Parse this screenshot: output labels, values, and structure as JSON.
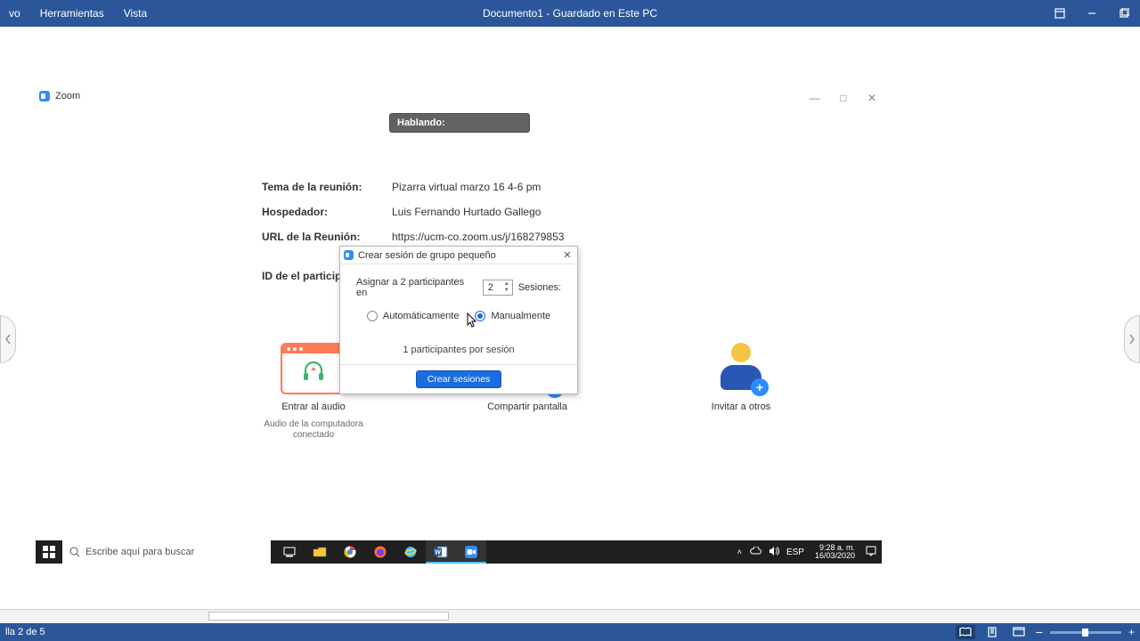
{
  "word": {
    "menu": {
      "archivo": "vo",
      "herramientas": "Herramientas",
      "vista": "Vista"
    },
    "title": "Documento1  -  Guardado en Este PC",
    "status_left": "lla 2 de 5"
  },
  "zoom_window": {
    "title": "Zoom",
    "speaking_label": "Hablando:",
    "info": {
      "topic_label": "Tema de la reunión:",
      "topic_value": "Pizarra virtual marzo 16 4-6 pm",
      "host_label": "Hospedador:",
      "host_value": "Luis Fernando Hurtado Gallego",
      "url_label": "URL de la Reunión:",
      "url_value": "https://ucm-co.zoom.us/j/168279853",
      "pid_label": "ID de el participan"
    },
    "tiles": {
      "audio": {
        "caption": "Entrar al audio",
        "sub": "Audio de la computadora conectado"
      },
      "share": {
        "caption": "Compartir pantalla"
      },
      "invite": {
        "caption": "Invitar a otros"
      }
    }
  },
  "breakout": {
    "title": "Crear sesión de grupo pequeño",
    "assign_prefix": "Asignar a 2 participantes en",
    "count": "2",
    "sessions_suffix": "Sesiones:",
    "auto": "Automáticamente",
    "manual": "Manualmente",
    "per_session": "1 participantes por sesión",
    "create_btn": "Crear sesiones"
  },
  "taskbar": {
    "search_placeholder": "Escribe aquí para buscar",
    "lang": "ESP",
    "time": "9:28 a. m.",
    "date": "16/03/2020"
  }
}
